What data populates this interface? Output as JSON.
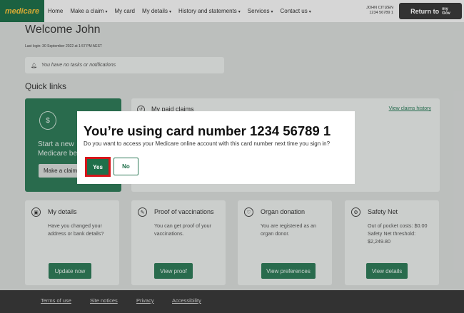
{
  "header": {
    "logo": "medicare",
    "nav": [
      {
        "label": "Home",
        "dropdown": false
      },
      {
        "label": "Make a claim",
        "dropdown": true
      },
      {
        "label": "My card",
        "dropdown": false
      },
      {
        "label": "My details",
        "dropdown": true
      },
      {
        "label": "History and statements",
        "dropdown": true
      },
      {
        "label": "Services",
        "dropdown": true
      },
      {
        "label": "Contact us",
        "dropdown": true
      }
    ],
    "user_name": "JOHN CITIZEN",
    "card_number": "1234 56789 1",
    "return_label": "Return to",
    "mygov_top": "my",
    "mygov_bottom": "Gov"
  },
  "page": {
    "welcome": "Welcome John",
    "last_login": "Last login: 30 September 2022 at 1:57 PM AEST",
    "notification": "You have no tasks or notifications",
    "quick_links": "Quick links"
  },
  "green_card": {
    "line1": "Start a new",
    "line2": "Medicare be",
    "button": "Make a claim"
  },
  "paid_claims": {
    "title": "My paid claims",
    "link": "View claims history"
  },
  "cards": [
    {
      "title": "My details",
      "desc": "Have you changed your address or bank details?",
      "button": "Update now",
      "icon": "person-card-icon"
    },
    {
      "title": "Proof of vaccinations",
      "desc": "You can get proof of your vaccinations.",
      "button": "View proof",
      "icon": "syringe-icon"
    },
    {
      "title": "Organ donation",
      "desc": "You are registered as an organ donor.",
      "button": "View preferences",
      "icon": "heart-icon"
    },
    {
      "title": "Safety Net",
      "desc": "Out of pocket costs: $0.00 Safety Net threshold: $2,249.80",
      "button": "View details",
      "icon": "safety-net-icon"
    }
  ],
  "footer": [
    "Terms of use",
    "Site notices",
    "Privacy",
    "Accessibility"
  ],
  "modal": {
    "title": "You’re using card number 1234 56789 1",
    "text": "Do you want to access your Medicare online account with this card number next time you sign in?",
    "yes": "Yes",
    "no": "No"
  },
  "colors": {
    "brand_green": "#1f6f4a",
    "logo_yellow": "#f6c13b",
    "highlight_red": "#d6161a"
  }
}
